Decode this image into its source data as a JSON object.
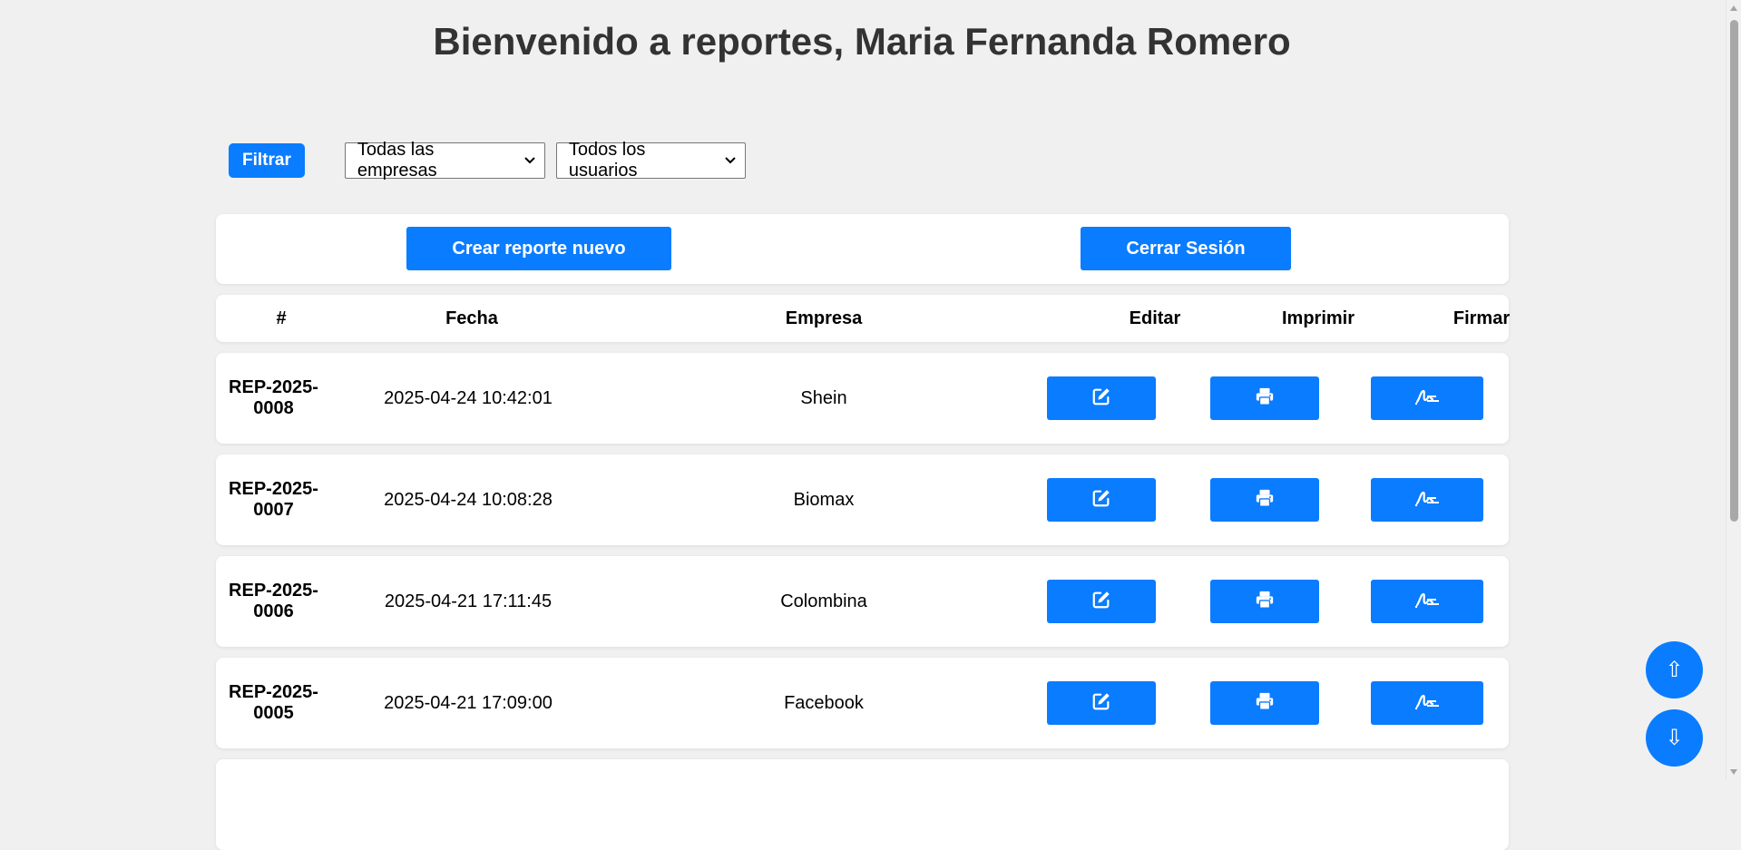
{
  "page": {
    "title": "Bienvenido a reportes, Maria Fernanda Romero"
  },
  "filters": {
    "filter_button": "Filtrar",
    "empresa_select": "Todas las empresas",
    "usuario_select": "Todos los usuarios"
  },
  "actions": {
    "new_report": "Crear reporte nuevo",
    "logout": "Cerrar Sesión"
  },
  "table": {
    "headers": {
      "number": "#",
      "date": "Fecha",
      "company": "Empresa",
      "edit": "Editar",
      "print": "Imprimir",
      "sign": "Firmar"
    },
    "rows": [
      {
        "id_line1": "REP-2025-",
        "id_line2": "0008",
        "date": "2025-04-24 10:42:01",
        "company": "Shein"
      },
      {
        "id_line1": "REP-2025-",
        "id_line2": "0007",
        "date": "2025-04-24 10:08:28",
        "company": "Biomax"
      },
      {
        "id_line1": "REP-2025-",
        "id_line2": "0006",
        "date": "2025-04-21 17:11:45",
        "company": "Colombina"
      },
      {
        "id_line1": "REP-2025-",
        "id_line2": "0005",
        "date": "2025-04-21 17:09:00",
        "company": "Facebook"
      }
    ]
  },
  "scroll_buttons": {
    "up": "⇧",
    "down": "⇩"
  },
  "colors": {
    "primary": "#0a7cff",
    "background": "#f0f0f0",
    "title": "#333333"
  }
}
